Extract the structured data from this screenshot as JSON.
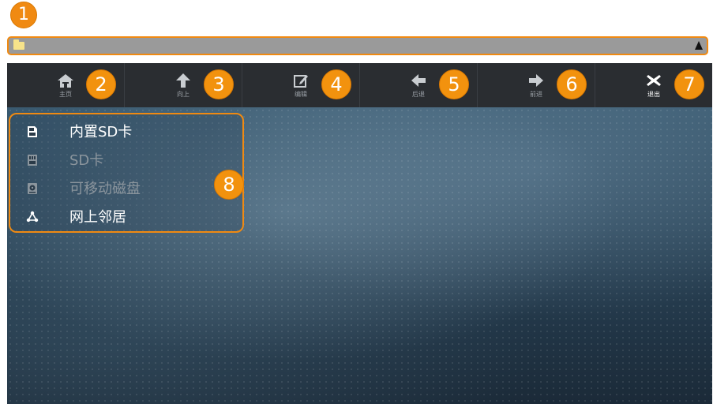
{
  "annotations": [
    "1",
    "2",
    "3",
    "4",
    "5",
    "6",
    "7",
    "8"
  ],
  "path_bar": {
    "folder_icon": "folder-icon",
    "expand_icon": "triangle-up-icon"
  },
  "toolbar": {
    "items": [
      {
        "label": "主页",
        "icon": "home-icon"
      },
      {
        "label": "向上",
        "icon": "arrow-up-icon"
      },
      {
        "label": "编辑",
        "icon": "edit-icon"
      },
      {
        "label": "后退",
        "icon": "arrow-left-icon"
      },
      {
        "label": "前进",
        "icon": "arrow-right-icon"
      },
      {
        "label": "退出",
        "icon": "close-icon"
      }
    ]
  },
  "drives": {
    "items": [
      {
        "label": "内置SD卡",
        "icon": "sd-card-icon",
        "enabled": true
      },
      {
        "label": "SD卡",
        "icon": "sd-card-icon",
        "enabled": false
      },
      {
        "label": "可移动磁盘",
        "icon": "removable-disk-icon",
        "enabled": false
      },
      {
        "label": "网上邻居",
        "icon": "network-icon",
        "enabled": true
      }
    ]
  },
  "colors": {
    "accent": "#f08a12",
    "toolbar_bg": "#2a2d31",
    "pathbar_bg": "#9a9a9a"
  }
}
